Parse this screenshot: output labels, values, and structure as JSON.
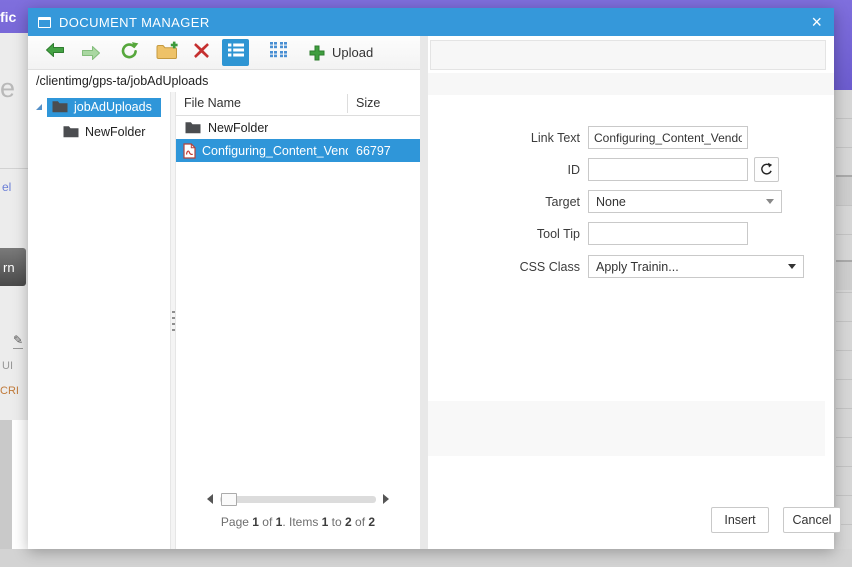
{
  "backdrop": {
    "header_fragment": "fic",
    "left_fragments": {
      "big_letter": "e",
      "link": "el",
      "button": "rn",
      "pen": "✎",
      "label1": "UI",
      "label2": "CRI"
    }
  },
  "dialog": {
    "title": "DOCUMENT MANAGER",
    "close": "×",
    "toolbar": {
      "upload_label": "Upload"
    },
    "path": "/clientimg/gps-ta/jobAdUploads",
    "tree": {
      "items": [
        {
          "label": "jobAdUploads",
          "selected": true,
          "expanded": true
        },
        {
          "label": "NewFolder",
          "selected": false
        }
      ]
    },
    "files": {
      "columns": {
        "name": "File Name",
        "size": "Size"
      },
      "rows": [
        {
          "name": "NewFolder",
          "size": "",
          "type": "folder",
          "selected": false
        },
        {
          "name": "Configuring_Content_Vendo",
          "size": "66797",
          "type": "pdf",
          "selected": true
        }
      ],
      "pager": {
        "segments": [
          {
            "t": "Page "
          },
          {
            "t": "1",
            "b": true
          },
          {
            "t": " of "
          },
          {
            "t": "1",
            "b": true
          },
          {
            "t": ". Items "
          },
          {
            "t": "1",
            "b": true
          },
          {
            "t": " to "
          },
          {
            "t": "2",
            "b": true
          },
          {
            "t": " of "
          },
          {
            "t": "2",
            "b": true
          }
        ]
      }
    },
    "form": {
      "link_text": {
        "label": "Link Text",
        "value": "Configuring_Content_Vendor"
      },
      "id": {
        "label": "ID",
        "value": ""
      },
      "target": {
        "label": "Target",
        "value": "None"
      },
      "tooltip": {
        "label": "Tool Tip",
        "value": ""
      },
      "css_class": {
        "label": "CSS Class",
        "value": "Apply Trainin..."
      }
    },
    "footer": {
      "insert": "Insert",
      "cancel": "Cancel"
    }
  },
  "colors": {
    "titlebar": "#3598da",
    "selection": "#2f96d9",
    "accent_green": "#3f9e3f",
    "purple": "#7768d6"
  }
}
